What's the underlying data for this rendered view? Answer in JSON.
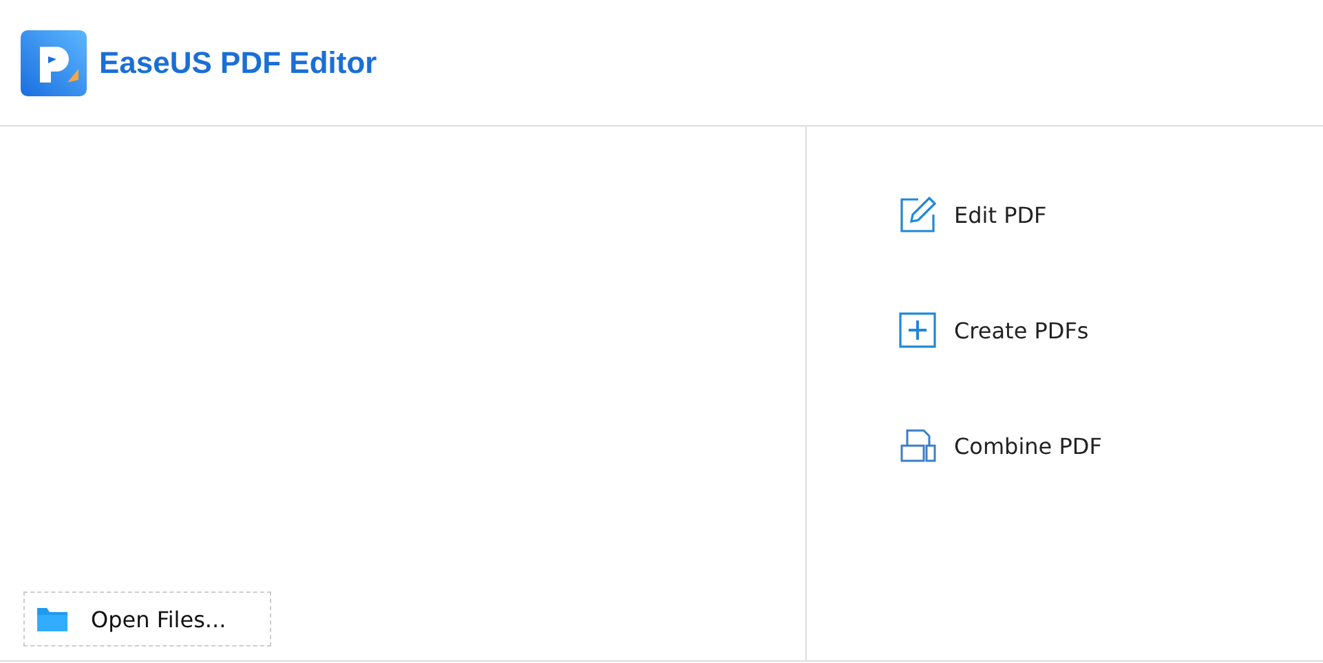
{
  "app": {
    "title": "EaseUS PDF Editor"
  },
  "open_button": {
    "label": "Open Files..."
  },
  "actions": [
    {
      "kind": "edit",
      "label": "Edit PDF"
    },
    {
      "kind": "create",
      "label": "Create PDFs"
    },
    {
      "kind": "combine",
      "label": "Combine PDF"
    }
  ]
}
